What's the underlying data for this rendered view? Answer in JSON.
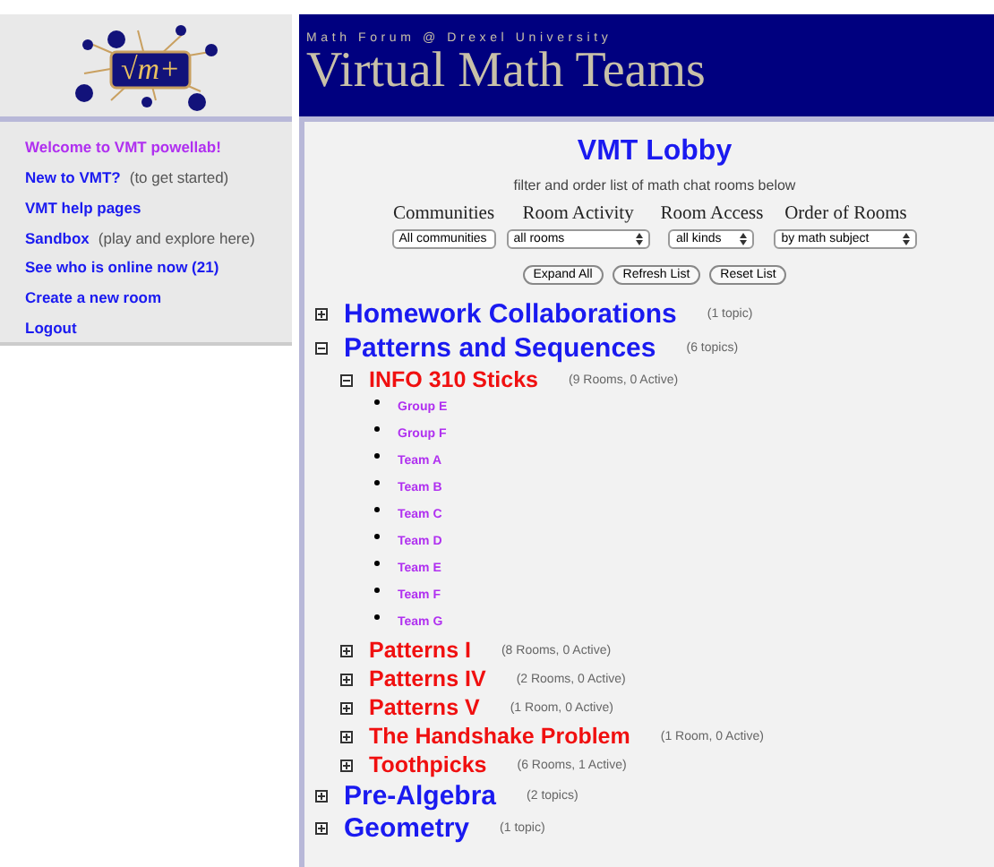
{
  "logo": {
    "text": "√m+"
  },
  "banner": {
    "subtitle": "Math Forum @ Drexel University",
    "title": "Virtual Math Teams"
  },
  "sidebar": {
    "items": [
      {
        "kind": "welcome",
        "label": "Welcome to VMT powellab!"
      },
      {
        "kind": "link",
        "label": "New to VMT?",
        "note": "(to get started)"
      },
      {
        "kind": "link",
        "label": "VMT help pages"
      },
      {
        "kind": "link",
        "label": "Sandbox",
        "note": "(play and explore here)"
      },
      {
        "kind": "link",
        "label": "See who is online now (21)"
      },
      {
        "kind": "link",
        "label": "Create a new room"
      },
      {
        "kind": "link",
        "label": "Logout"
      }
    ]
  },
  "lobby": {
    "title": "VMT Lobby",
    "subtitle": "filter and order list of math chat rooms below",
    "filters": [
      {
        "label": "Communities",
        "value": "All communities"
      },
      {
        "label": "Room Activity",
        "value": "all rooms"
      },
      {
        "label": "Room Access",
        "value": "all kinds"
      },
      {
        "label": "Order of Rooms",
        "value": "by math subject"
      }
    ],
    "buttons": [
      "Expand All",
      "Refresh List",
      "Reset List"
    ]
  },
  "tree": [
    {
      "name": "Homework Collaborations",
      "count": "(1 topic)",
      "expanded": false
    },
    {
      "name": "Patterns and Sequences",
      "count": "(6 topics)",
      "expanded": true,
      "children": [
        {
          "name": "INFO 310 Sticks",
          "count": "(9 Rooms, 0 Active)",
          "expanded": true,
          "rooms": [
            "Group E",
            "Group F",
            "Team A",
            "Team B",
            "Team C",
            "Team D",
            "Team E",
            "Team F",
            "Team G"
          ]
        },
        {
          "name": "Patterns I",
          "count": "(8 Rooms, 0 Active)",
          "expanded": false
        },
        {
          "name": "Patterns IV",
          "count": "(2 Rooms, 0 Active)",
          "expanded": false
        },
        {
          "name": "Patterns V",
          "count": "(1 Room, 0 Active)",
          "expanded": false
        },
        {
          "name": "The Handshake Problem",
          "count": "(1 Room, 0 Active)",
          "expanded": false
        },
        {
          "name": "Toothpicks",
          "count": "(6 Rooms, 1 Active)",
          "expanded": false
        }
      ]
    },
    {
      "name": "Pre-Algebra",
      "count": "(2 topics)",
      "expanded": false
    },
    {
      "name": "Geometry",
      "count": "(1 topic)",
      "expanded": false
    }
  ]
}
